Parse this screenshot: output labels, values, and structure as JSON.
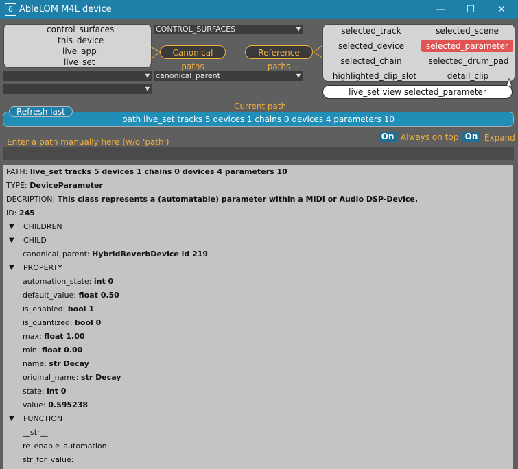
{
  "window": {
    "title": "AbleLOM M4L device",
    "minimize": "—",
    "maximize": "☐",
    "close": "✕",
    "icon": "ẟ"
  },
  "canonical_roots": [
    "control_surfaces",
    "this_device",
    "live_app",
    "live_set"
  ],
  "dropdowns": {
    "control_surfaces": "CONTROL_SURFACES",
    "parent": "canonical_parent",
    "left1": "",
    "left2": ""
  },
  "pills": {
    "canonical": "Canonical paths",
    "reference": "Reference paths"
  },
  "reference_paths": {
    "selected_track": "selected_track",
    "selected_scene": "selected_scene",
    "selected_device": "selected_device",
    "selected_parameter": "selected_parameter",
    "selected_chain": "selected_chain",
    "selected_drum_pad": "selected_drum_pad",
    "highlighted_clip_slot": "highlighted_clip_slot",
    "detail_clip": "detail_clip"
  },
  "speech": "live_set view selected_parameter",
  "refresh_label": "Refresh last",
  "current_path_label": "Current path",
  "current_path": "path live_set tracks 5 devices 1 chains 0 devices 4 parameters 10",
  "manual_hint": "Enter a path manually here (w/o 'path')",
  "toggles": {
    "always_on_top": {
      "state": "On",
      "label": "Always on top"
    },
    "expand": {
      "state": "On",
      "label": "Expand"
    }
  },
  "info": {
    "path": {
      "k": "PATH:",
      "v": "live_set tracks 5 devices 1 chains 0 devices 4 parameters 10"
    },
    "type": {
      "k": "TYPE:",
      "v": "DeviceParameter"
    },
    "description": {
      "k": "DECRIPTION:",
      "v": "This class represents a (automatable) parameter within a MIDI or Audio DSP-Device."
    },
    "id": {
      "k": "ID:",
      "v": "245"
    },
    "children": "CHILDREN",
    "child": "CHILD",
    "canonical_parent": {
      "k": "canonical_parent:",
      "v": "HybridReverbDevice id 219"
    },
    "property": "PROPERTY",
    "properties": [
      {
        "k": "automation_state:",
        "v": "int 0"
      },
      {
        "k": "default_value:",
        "v": "float 0.50"
      },
      {
        "k": "is_enabled:",
        "v": "bool 1"
      },
      {
        "k": "is_quantized:",
        "v": "bool 0"
      },
      {
        "k": "max:",
        "v": "float 1.00"
      },
      {
        "k": "min:",
        "v": "float 0.00"
      },
      {
        "k": "name:",
        "v": "str Decay"
      },
      {
        "k": "original_name:",
        "v": "str Decay"
      },
      {
        "k": "state:",
        "v": "int 0"
      },
      {
        "k": "value:",
        "v": "0.595238"
      }
    ],
    "function": "FUNCTION",
    "functions": [
      "__str__:",
      "re_enable_automation:",
      "str_for_value:"
    ]
  },
  "colors": {
    "accent": "#1e7fa8",
    "orange": "#f0b040",
    "selected": "#e05454"
  }
}
